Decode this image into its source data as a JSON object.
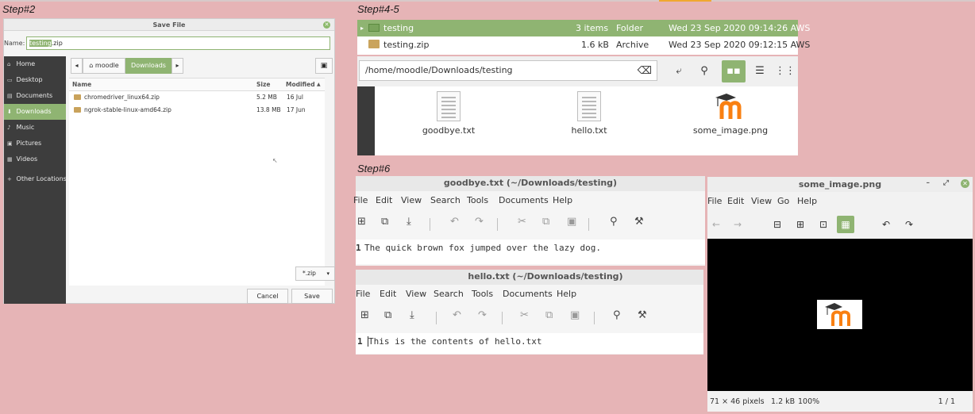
{
  "steps": {
    "s2": "Step#2",
    "s45": "Step#4-5",
    "s6": "Step#6"
  },
  "save_dialog": {
    "title": "Save File",
    "name_label": "Name:",
    "filename_selected": "testing",
    "filename_ext": ".zip",
    "sidebar": [
      "Home",
      "Desktop",
      "Documents",
      "Downloads",
      "Music",
      "Pictures",
      "Videos",
      "Other Locations"
    ],
    "crumbs": [
      "moodle",
      "Downloads"
    ],
    "columns": {
      "name": "Name",
      "size": "Size",
      "modified": "Modified"
    },
    "files": [
      {
        "name": "chromedriver_linux64.zip",
        "size": "5.2 MB",
        "modified": "16 Jul"
      },
      {
        "name": "ngrok-stable-linux-amd64.zip",
        "size": "13.8 MB",
        "modified": "17 Jun"
      }
    ],
    "filter": "*.zip",
    "cancel": "Cancel",
    "save": "Save"
  },
  "file_list": [
    {
      "name": "testing",
      "items": "3 items",
      "type": "Folder",
      "date": "Wed 23 Sep 2020 09:14:26 AWS"
    },
    {
      "name": "testing.zip",
      "items": "1.6 kB",
      "type": "Archive",
      "date": "Wed 23 Sep 2020 09:12:15 AWS"
    }
  ],
  "nemo": {
    "path": "/home/moodle/Downloads/testing",
    "icons": [
      "goodbye.txt",
      "hello.txt",
      "some_image.png"
    ]
  },
  "gedit1": {
    "title": "goodbye.txt (~/Downloads/testing)",
    "menu": [
      "File",
      "Edit",
      "View",
      "Search",
      "Tools",
      "Documents",
      "Help"
    ],
    "line_no": "1",
    "content": "The quick brown fox jumped over the lazy dog."
  },
  "gedit2": {
    "title": "hello.txt (~/Downloads/testing)",
    "menu": [
      "File",
      "Edit",
      "View",
      "Search",
      "Tools",
      "Documents",
      "Help"
    ],
    "line_no": "1",
    "content": "This is the contents of hello.txt"
  },
  "viewer": {
    "title": "some_image.png",
    "menu": [
      "File",
      "Edit",
      "View",
      "Go",
      "Help"
    ],
    "status_dims": "71 × 46 pixels",
    "status_size": "1.2 kB",
    "status_zoom": "100%",
    "status_page": "1 / 1"
  },
  "colors": {
    "accent": "#8fb472",
    "background": "#e6b4b6",
    "moodle_orange": "#f98012"
  }
}
